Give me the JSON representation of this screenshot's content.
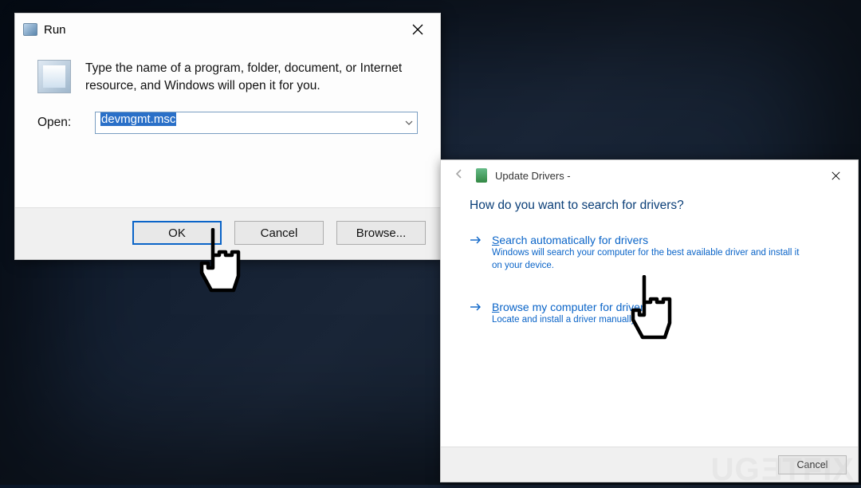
{
  "run": {
    "title": "Run",
    "description": "Type the name of a program, folder, document, or Internet resource, and Windows will open it for you.",
    "open_label": "Open:",
    "input_value": "devmgmt.msc",
    "buttons": {
      "ok": "OK",
      "cancel": "Cancel",
      "browse": "Browse..."
    }
  },
  "update_drivers": {
    "title": "Update Drivers -",
    "heading": "How do you want to search for drivers?",
    "options": [
      {
        "title_prefix": "S",
        "title_rest": "earch automatically for drivers",
        "description": "Windows will search your computer for the best available driver and install it on your device."
      },
      {
        "title_prefix": "B",
        "title_rest": "rowse my computer for drivers",
        "description": "Locate and install a driver manually."
      }
    ],
    "cancel": "Cancel"
  },
  "watermark": "UGETFIX"
}
